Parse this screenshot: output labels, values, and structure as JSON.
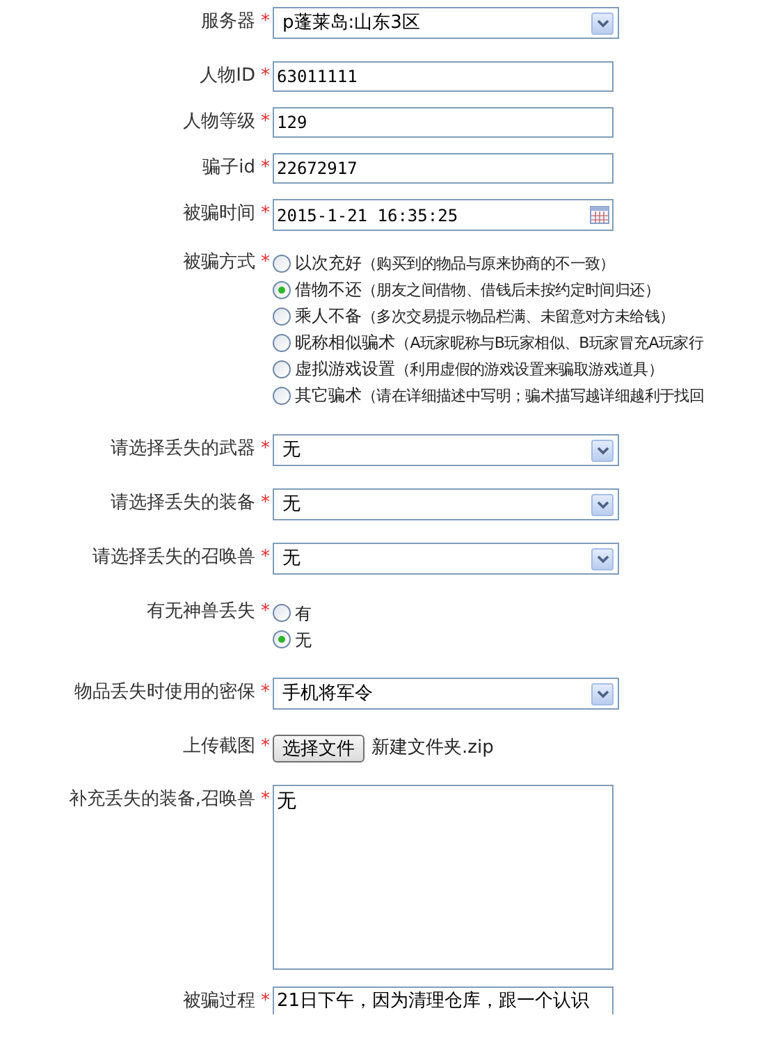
{
  "fields": [
    {
      "kind": "select",
      "label": "服务器",
      "marker": "*",
      "value": "p蓬莱岛:山东3区"
    },
    {
      "kind": "text",
      "label": "人物ID",
      "marker": "*",
      "value": "63011111"
    },
    {
      "kind": "text",
      "label": "人物等级",
      "marker": "*",
      "value": "129"
    },
    {
      "kind": "text",
      "label": "骗子id",
      "marker": "*",
      "value": "22672917"
    },
    {
      "kind": "date",
      "label": "被骗时间",
      "marker": "*",
      "value": "2015-1-21 16:35:25"
    },
    {
      "kind": "radio",
      "label": "被骗方式",
      "marker": "*",
      "options": [
        {
          "label": "以次充好",
          "note": "（购买到的物品与原来协商的不一致）",
          "selected": false
        },
        {
          "label": "借物不还",
          "note": "（朋友之间借物、借钱后未按约定时间归还）",
          "selected": true
        },
        {
          "label": "乘人不备",
          "note": "（多次交易提示物品栏满、未留意对方未给钱）",
          "selected": false
        },
        {
          "label": "昵称相似骗术",
          "note": "（A玩家昵称与B玩家相似、B玩家冒充A玩家行",
          "selected": false
        },
        {
          "label": "虚拟游戏设置",
          "note": "（利用虚假的游戏设置来骗取游戏道具）",
          "selected": false
        },
        {
          "label": "其它骗术",
          "note": "（请在详细描述中写明；骗术描写越详细越利于找回",
          "selected": false
        }
      ]
    },
    {
      "kind": "select",
      "label": "请选择丢失的武器",
      "marker": "*",
      "value": "无"
    },
    {
      "kind": "select",
      "label": "请选择丢失的装备",
      "marker": "*",
      "value": "无"
    },
    {
      "kind": "select",
      "label": "请选择丢失的召唤兽",
      "marker": "*",
      "value": "无"
    },
    {
      "kind": "radio",
      "label": "有无神兽丢失",
      "marker": "*",
      "options": [
        {
          "label": "有",
          "selected": false
        },
        {
          "label": "无",
          "selected": true
        }
      ]
    },
    {
      "kind": "select",
      "label": "物品丢失时使用的密保",
      "marker": "*",
      "value": "手机将军令"
    },
    {
      "kind": "file",
      "label": "上传截图",
      "marker": "*",
      "button": "选择文件",
      "value": "新建文件夹.zip"
    },
    {
      "kind": "textarea",
      "label": "补充丢失的装备,召唤兽",
      "marker": "*",
      "value": "无"
    },
    {
      "kind": "textarea_short",
      "label": "被骗过程",
      "marker": "*",
      "value": "21日下午，因为清理仓库，跟一个认识"
    }
  ]
}
